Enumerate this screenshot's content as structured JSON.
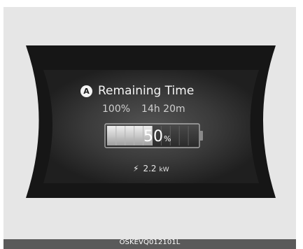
{
  "display": {
    "badge": "A",
    "title": "Remaining Time",
    "target_charge": "100%",
    "remaining_time": "14h 20m",
    "charge_percent_value": "50",
    "charge_percent_unit": "%",
    "charge_level": 0.5,
    "power_icon": "lightning-bolt-icon",
    "power_value": "2.2",
    "power_unit": "kW"
  },
  "footer": {
    "code": "OSKEVQ012101L"
  },
  "colors": {
    "frame_bg": "#e6e6e6",
    "screen_dark": "#141414",
    "screen_center": "#4c4c4c",
    "battery_fill": "#d0d0d0",
    "footer_bar": "#5a5a5a"
  }
}
